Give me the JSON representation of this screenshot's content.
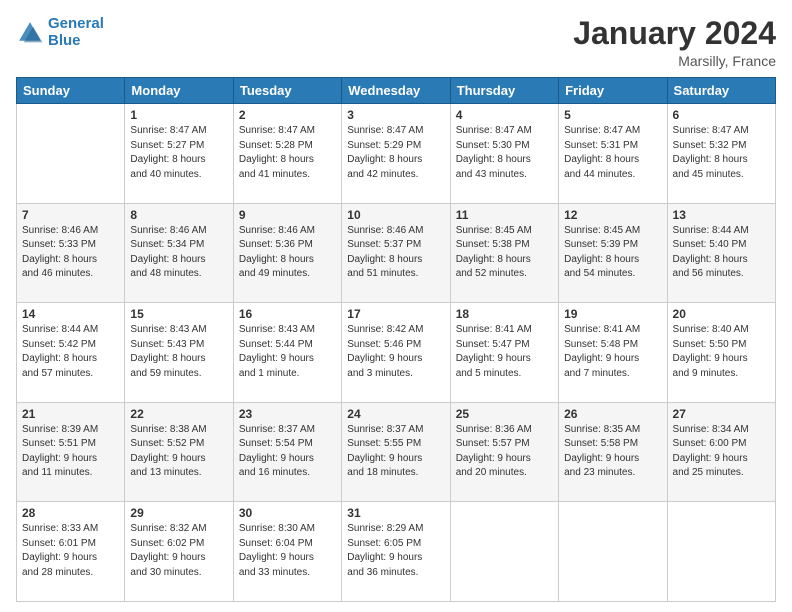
{
  "logo": {
    "line1": "General",
    "line2": "Blue"
  },
  "title": "January 2024",
  "subtitle": "Marsilly, France",
  "days_of_week": [
    "Sunday",
    "Monday",
    "Tuesday",
    "Wednesday",
    "Thursday",
    "Friday",
    "Saturday"
  ],
  "weeks": [
    [
      {
        "day": "",
        "info": ""
      },
      {
        "day": "1",
        "info": "Sunrise: 8:47 AM\nSunset: 5:27 PM\nDaylight: 8 hours\nand 40 minutes."
      },
      {
        "day": "2",
        "info": "Sunrise: 8:47 AM\nSunset: 5:28 PM\nDaylight: 8 hours\nand 41 minutes."
      },
      {
        "day": "3",
        "info": "Sunrise: 8:47 AM\nSunset: 5:29 PM\nDaylight: 8 hours\nand 42 minutes."
      },
      {
        "day": "4",
        "info": "Sunrise: 8:47 AM\nSunset: 5:30 PM\nDaylight: 8 hours\nand 43 minutes."
      },
      {
        "day": "5",
        "info": "Sunrise: 8:47 AM\nSunset: 5:31 PM\nDaylight: 8 hours\nand 44 minutes."
      },
      {
        "day": "6",
        "info": "Sunrise: 8:47 AM\nSunset: 5:32 PM\nDaylight: 8 hours\nand 45 minutes."
      }
    ],
    [
      {
        "day": "7",
        "info": "Sunrise: 8:46 AM\nSunset: 5:33 PM\nDaylight: 8 hours\nand 46 minutes."
      },
      {
        "day": "8",
        "info": "Sunrise: 8:46 AM\nSunset: 5:34 PM\nDaylight: 8 hours\nand 48 minutes."
      },
      {
        "day": "9",
        "info": "Sunrise: 8:46 AM\nSunset: 5:36 PM\nDaylight: 8 hours\nand 49 minutes."
      },
      {
        "day": "10",
        "info": "Sunrise: 8:46 AM\nSunset: 5:37 PM\nDaylight: 8 hours\nand 51 minutes."
      },
      {
        "day": "11",
        "info": "Sunrise: 8:45 AM\nSunset: 5:38 PM\nDaylight: 8 hours\nand 52 minutes."
      },
      {
        "day": "12",
        "info": "Sunrise: 8:45 AM\nSunset: 5:39 PM\nDaylight: 8 hours\nand 54 minutes."
      },
      {
        "day": "13",
        "info": "Sunrise: 8:44 AM\nSunset: 5:40 PM\nDaylight: 8 hours\nand 56 minutes."
      }
    ],
    [
      {
        "day": "14",
        "info": "Sunrise: 8:44 AM\nSunset: 5:42 PM\nDaylight: 8 hours\nand 57 minutes."
      },
      {
        "day": "15",
        "info": "Sunrise: 8:43 AM\nSunset: 5:43 PM\nDaylight: 8 hours\nand 59 minutes."
      },
      {
        "day": "16",
        "info": "Sunrise: 8:43 AM\nSunset: 5:44 PM\nDaylight: 9 hours\nand 1 minute."
      },
      {
        "day": "17",
        "info": "Sunrise: 8:42 AM\nSunset: 5:46 PM\nDaylight: 9 hours\nand 3 minutes."
      },
      {
        "day": "18",
        "info": "Sunrise: 8:41 AM\nSunset: 5:47 PM\nDaylight: 9 hours\nand 5 minutes."
      },
      {
        "day": "19",
        "info": "Sunrise: 8:41 AM\nSunset: 5:48 PM\nDaylight: 9 hours\nand 7 minutes."
      },
      {
        "day": "20",
        "info": "Sunrise: 8:40 AM\nSunset: 5:50 PM\nDaylight: 9 hours\nand 9 minutes."
      }
    ],
    [
      {
        "day": "21",
        "info": "Sunrise: 8:39 AM\nSunset: 5:51 PM\nDaylight: 9 hours\nand 11 minutes."
      },
      {
        "day": "22",
        "info": "Sunrise: 8:38 AM\nSunset: 5:52 PM\nDaylight: 9 hours\nand 13 minutes."
      },
      {
        "day": "23",
        "info": "Sunrise: 8:37 AM\nSunset: 5:54 PM\nDaylight: 9 hours\nand 16 minutes."
      },
      {
        "day": "24",
        "info": "Sunrise: 8:37 AM\nSunset: 5:55 PM\nDaylight: 9 hours\nand 18 minutes."
      },
      {
        "day": "25",
        "info": "Sunrise: 8:36 AM\nSunset: 5:57 PM\nDaylight: 9 hours\nand 20 minutes."
      },
      {
        "day": "26",
        "info": "Sunrise: 8:35 AM\nSunset: 5:58 PM\nDaylight: 9 hours\nand 23 minutes."
      },
      {
        "day": "27",
        "info": "Sunrise: 8:34 AM\nSunset: 6:00 PM\nDaylight: 9 hours\nand 25 minutes."
      }
    ],
    [
      {
        "day": "28",
        "info": "Sunrise: 8:33 AM\nSunset: 6:01 PM\nDaylight: 9 hours\nand 28 minutes."
      },
      {
        "day": "29",
        "info": "Sunrise: 8:32 AM\nSunset: 6:02 PM\nDaylight: 9 hours\nand 30 minutes."
      },
      {
        "day": "30",
        "info": "Sunrise: 8:30 AM\nSunset: 6:04 PM\nDaylight: 9 hours\nand 33 minutes."
      },
      {
        "day": "31",
        "info": "Sunrise: 8:29 AM\nSunset: 6:05 PM\nDaylight: 9 hours\nand 36 minutes."
      },
      {
        "day": "",
        "info": ""
      },
      {
        "day": "",
        "info": ""
      },
      {
        "day": "",
        "info": ""
      }
    ]
  ]
}
